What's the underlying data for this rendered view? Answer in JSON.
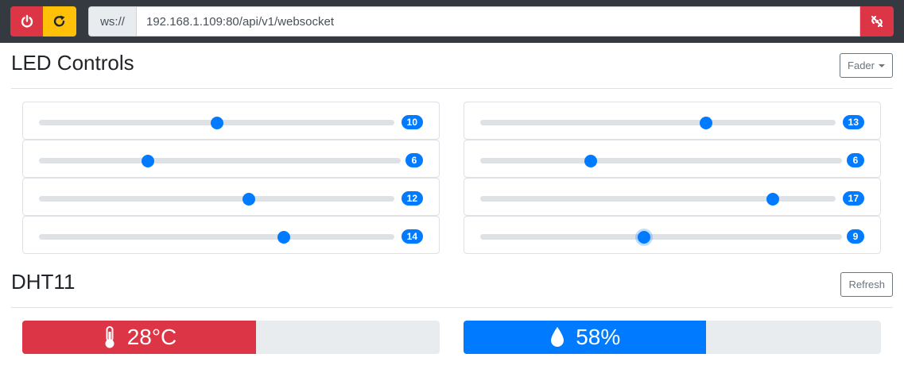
{
  "toolbar": {
    "power_icon": "power-icon",
    "reload_icon": "reload-icon",
    "url_prefix": "ws://",
    "url_value": "192.168.1.109:80/api/v1/websocket",
    "disconnect_icon": "disconnected-icon"
  },
  "led_section": {
    "title": "LED Controls",
    "mode_button": "Fader"
  },
  "sliders_left": [
    {
      "value": "10",
      "fraction": 0.5
    },
    {
      "value": "6",
      "fraction": 0.3
    },
    {
      "value": "12",
      "fraction": 0.59
    },
    {
      "value": "14",
      "fraction": 0.69
    }
  ],
  "sliders_right": [
    {
      "value": "13",
      "fraction": 0.635
    },
    {
      "value": "6",
      "fraction": 0.305
    },
    {
      "value": "17",
      "fraction": 0.824
    },
    {
      "value": "9",
      "fraction": 0.452
    }
  ],
  "dht_section": {
    "title": "DHT11",
    "refresh_button": "Refresh"
  },
  "temperature": {
    "label": "28°C",
    "fraction": 0.56,
    "color": "#dc3545",
    "icon": "thermometer-icon"
  },
  "humidity": {
    "label": "58%",
    "fraction": 0.58,
    "color": "#007bff",
    "icon": "water-drop-icon"
  }
}
